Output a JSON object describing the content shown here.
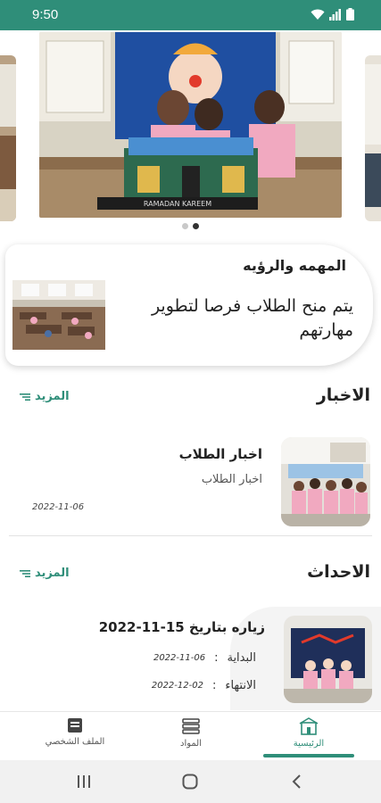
{
  "status_bar": {
    "time": "9:50"
  },
  "carousel": {
    "slide_count": 2,
    "active_index": 1,
    "banner_text": "RAMADAN KAREEM"
  },
  "mission": {
    "title": "المهمه والرؤيه",
    "text": "يتم منح الطلاب فرصا لتطوير مهارتهم"
  },
  "news": {
    "section_title": "الاخبار",
    "more_label": "المزيد",
    "items": [
      {
        "title": "اخبار الطلاب",
        "subtitle": "اخبار الطلاب",
        "date": "2022-11-06"
      }
    ]
  },
  "events": {
    "section_title": "الاحداث",
    "more_label": "المزيد",
    "items": [
      {
        "title": "زياره بتاريخ 15-11-2022",
        "start_label": "البداية",
        "start_value": "2022-11-06",
        "end_label": "الانتهاء",
        "end_value": "2022-12-02"
      }
    ]
  },
  "bottom_nav": {
    "items": [
      {
        "label": "الرئيسية",
        "icon": "home-icon",
        "active": true
      },
      {
        "label": "المواد",
        "icon": "books-icon",
        "active": false
      },
      {
        "label": "الملف الشخصي",
        "icon": "profile-card-icon",
        "active": false
      }
    ]
  },
  "colors": {
    "accent": "#2f8e79",
    "status_bar": "#2f8e79"
  }
}
